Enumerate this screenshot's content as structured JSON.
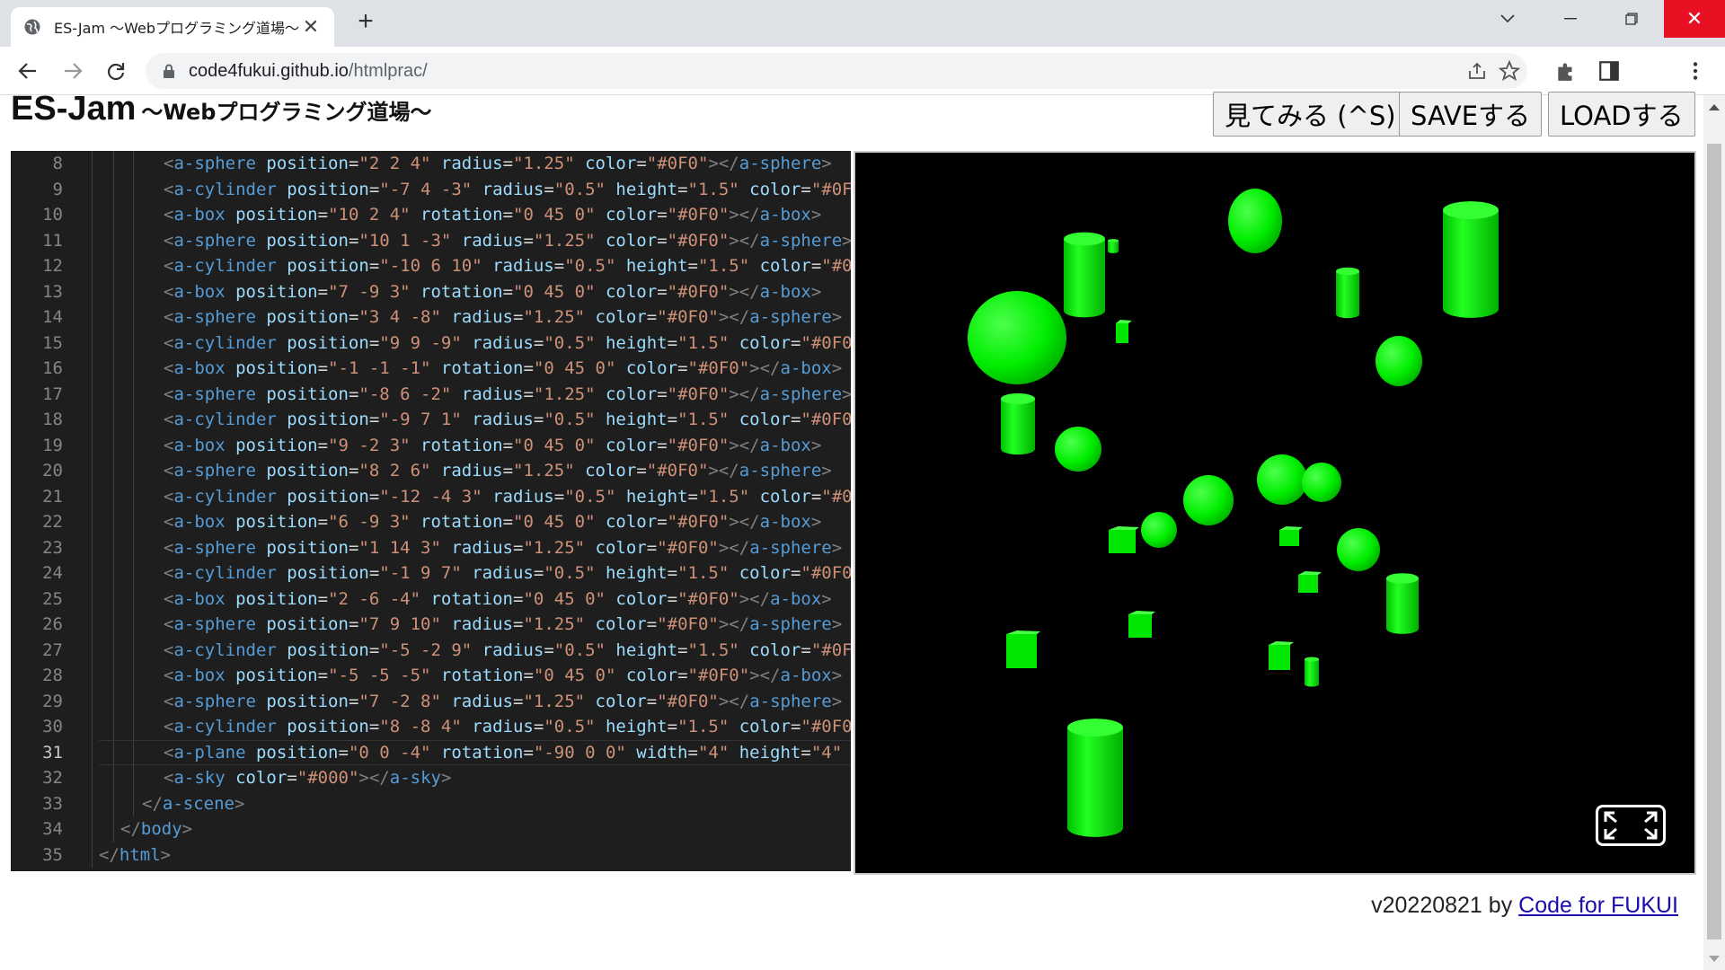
{
  "browser": {
    "tab_title": "ES-Jam ～Webプログラミング道場～",
    "url_host": "code4fukui.github.io",
    "url_path": "/htmlprac/"
  },
  "page": {
    "title": "ES-Jam",
    "subtitle": "～Webプログラミング道場～",
    "buttons": {
      "view": "見てみる (^S)",
      "save": "SAVEする",
      "load": "LOADする"
    },
    "footer_version": "v20220821 by",
    "footer_link": "Code for FUKUI"
  },
  "editor": {
    "active_line": 31,
    "lines": [
      {
        "n": 8,
        "indent": 3,
        "text": "<a-sphere position=\"2 2 4\" radius=\"1.25\" color=\"#0F0\"></a-sphere>"
      },
      {
        "n": 9,
        "indent": 3,
        "text": "<a-cylinder position=\"-7 4 -3\" radius=\"0.5\" height=\"1.5\" color=\"#0F"
      },
      {
        "n": 10,
        "indent": 3,
        "text": "<a-box position=\"10 2 4\" rotation=\"0 45 0\" color=\"#0F0\"></a-box>"
      },
      {
        "n": 11,
        "indent": 3,
        "text": "<a-sphere position=\"10 1 -3\" radius=\"1.25\" color=\"#0F0\"></a-sphere>"
      },
      {
        "n": 12,
        "indent": 3,
        "text": "<a-cylinder position=\"-10 6 10\" radius=\"0.5\" height=\"1.5\" color=\"#0"
      },
      {
        "n": 13,
        "indent": 3,
        "text": "<a-box position=\"7 -9 3\" rotation=\"0 45 0\" color=\"#0F0\"></a-box>"
      },
      {
        "n": 14,
        "indent": 3,
        "text": "<a-sphere position=\"3 4 -8\" radius=\"1.25\" color=\"#0F0\"></a-sphere>"
      },
      {
        "n": 15,
        "indent": 3,
        "text": "<a-cylinder position=\"9 9 -9\" radius=\"0.5\" height=\"1.5\" color=\"#0F0"
      },
      {
        "n": 16,
        "indent": 3,
        "text": "<a-box position=\"-1 -1 -1\" rotation=\"0 45 0\" color=\"#0F0\"></a-box>"
      },
      {
        "n": 17,
        "indent": 3,
        "text": "<a-sphere position=\"-8 6 -2\" radius=\"1.25\" color=\"#0F0\"></a-sphere>"
      },
      {
        "n": 18,
        "indent": 3,
        "text": "<a-cylinder position=\"-9 7 1\" radius=\"0.5\" height=\"1.5\" color=\"#0F0"
      },
      {
        "n": 19,
        "indent": 3,
        "text": "<a-box position=\"9 -2 3\" rotation=\"0 45 0\" color=\"#0F0\"></a-box>"
      },
      {
        "n": 20,
        "indent": 3,
        "text": "<a-sphere position=\"8 2 6\" radius=\"1.25\" color=\"#0F0\"></a-sphere>"
      },
      {
        "n": 21,
        "indent": 3,
        "text": "<a-cylinder position=\"-12 -4 3\" radius=\"0.5\" height=\"1.5\" color=\"#0"
      },
      {
        "n": 22,
        "indent": 3,
        "text": "<a-box position=\"6 -9 3\" rotation=\"0 45 0\" color=\"#0F0\"></a-box>"
      },
      {
        "n": 23,
        "indent": 3,
        "text": "<a-sphere position=\"1 14 3\" radius=\"1.25\" color=\"#0F0\"></a-sphere>"
      },
      {
        "n": 24,
        "indent": 3,
        "text": "<a-cylinder position=\"-1 9 7\" radius=\"0.5\" height=\"1.5\" color=\"#0F0"
      },
      {
        "n": 25,
        "indent": 3,
        "text": "<a-box position=\"2 -6 -4\" rotation=\"0 45 0\" color=\"#0F0\"></a-box>"
      },
      {
        "n": 26,
        "indent": 3,
        "text": "<a-sphere position=\"7 9 10\" radius=\"1.25\" color=\"#0F0\"></a-sphere>"
      },
      {
        "n": 27,
        "indent": 3,
        "text": "<a-cylinder position=\"-5 -2 9\" radius=\"0.5\" height=\"1.5\" color=\"#0F"
      },
      {
        "n": 28,
        "indent": 3,
        "text": "<a-box position=\"-5 -5 -5\" rotation=\"0 45 0\" color=\"#0F0\"></a-box>"
      },
      {
        "n": 29,
        "indent": 3,
        "text": "<a-sphere position=\"7 -2 8\" radius=\"1.25\" color=\"#0F0\"></a-sphere>"
      },
      {
        "n": 30,
        "indent": 3,
        "text": "<a-cylinder position=\"8 -8 4\" radius=\"0.5\" height=\"1.5\" color=\"#0F0"
      },
      {
        "n": 31,
        "indent": 3,
        "text": "<a-plane position=\"0 0 -4\" rotation=\"-90 0 0\" width=\"4\" height=\"4\""
      },
      {
        "n": 32,
        "indent": 3,
        "text": "<a-sky color=\"#000\"></a-sky>"
      },
      {
        "n": 33,
        "indent": 2,
        "text": "</a-scene>"
      },
      {
        "n": 34,
        "indent": 1,
        "text": "</body>"
      },
      {
        "n": 35,
        "indent": 0,
        "text": "</html>"
      }
    ]
  },
  "scene": {
    "background": "#000000",
    "object_color": "#00ff00",
    "fullscreen_icon": "expand-icon"
  },
  "colors": {
    "tag": "#569cd6",
    "attr": "#9cdcfe",
    "value": "#ce9178",
    "close_button": "#e81123"
  }
}
